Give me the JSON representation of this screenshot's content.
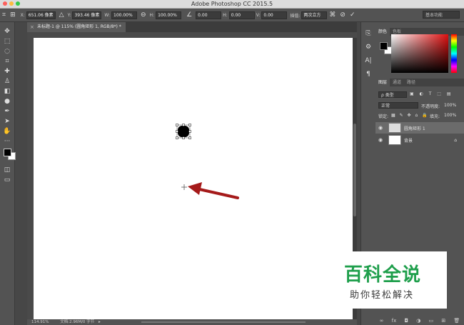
{
  "window": {
    "title": "Adobe Photoshop CC 2015.5"
  },
  "options_bar": {
    "x_label": "X:",
    "x_value": "651.06 像素",
    "y_label": "Y:",
    "y_value": "393.46 像素",
    "w_label": "W:",
    "w_value": "100.00%",
    "h_label": "H:",
    "h_value": "100.00%",
    "angle_value": "0.00",
    "hskew_label": "H:",
    "hskew_value": "0.00",
    "vskew_label": "V:",
    "vskew_value": "0.00",
    "interp_label": "插值:",
    "interp_value": "两次立方",
    "workspace": "基本功能"
  },
  "document": {
    "tab_title": "未标题-1 @ 115% (圆角矩形 1, RGB/8*) *",
    "zoom": "114.91%",
    "doc_size": "文档:2.96M/0 字节"
  },
  "color_panel": {
    "tabs": [
      "颜色",
      "色板"
    ],
    "foreground": "#000000",
    "background": "#ffffff"
  },
  "layers_panel": {
    "tabs": [
      "图层",
      "通道",
      "路径"
    ],
    "filter_placeholder": "ρ 类型",
    "blend_mode": "正常",
    "opacity_label": "不透明度:",
    "opacity_value": "100%",
    "lock_label": "锁定:",
    "fill_label": "填充:",
    "fill_value": "100%",
    "layers": [
      {
        "name": "圆角矩形 1",
        "selected": true
      },
      {
        "name": "背景",
        "selected": false
      }
    ]
  },
  "watermark": {
    "title": "百科全说",
    "subtitle": "助你轻松解决"
  }
}
